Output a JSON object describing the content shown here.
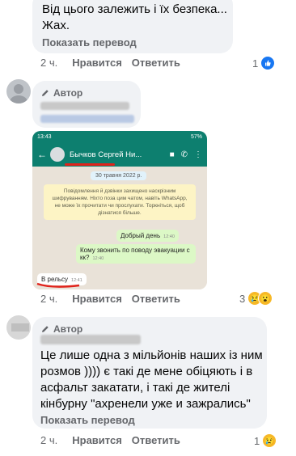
{
  "comment1": {
    "text_line1": "Від цього залежить і їх безпека...",
    "text_line2": "Жах.",
    "see_translation": "Показать перевод",
    "time": "2 ч.",
    "like": "Нравится",
    "reply": "Ответить",
    "reactions_count": "1"
  },
  "comment2": {
    "author_tag": "Автор",
    "wa": {
      "status_time": "13:43",
      "status_battery": "57%",
      "contact_name": "Бычков Сергей Ни...",
      "date": "30 травня 2022 р.",
      "notice": "Повідомлення й дзвінки захищено наскрізним шифруванням. Ніхто поза цим чатом, навіть WhatsApp, не може їх прочитати чи прослухати. Торкніться, щоб дізнатися більше.",
      "msg1": "Добрый день",
      "msg1_time": "12:40",
      "msg2": "Кому звонить по поводу эвакуации с кк?",
      "msg2_time": "12:40",
      "msg3": "В рельсу",
      "msg3_time": "12:41"
    },
    "time": "2 ч.",
    "like": "Нравится",
    "reply": "Ответить",
    "reactions_count": "3"
  },
  "comment3": {
    "author_tag": "Автор",
    "text_line1": "Це лише одна з мільйонів наших із ним",
    "text_line2": "розмов )))) є такі де мене обіцяють і в",
    "text_line3": "асфальт закатати, і такі де жителі",
    "text_line4": "кінбурну \"ахренели уже и зажрались\"",
    "see_translation": "Показать перевод",
    "time": "2 ч.",
    "like": "Нравится",
    "reply": "Ответить",
    "reactions_count": "1"
  },
  "colors": {
    "bubble": "#f0f2f5",
    "secondary_text": "#65676b",
    "whatsapp_header": "#0d7f6f",
    "like_blue": "#1877f2",
    "underline_red": "#e0231b"
  }
}
